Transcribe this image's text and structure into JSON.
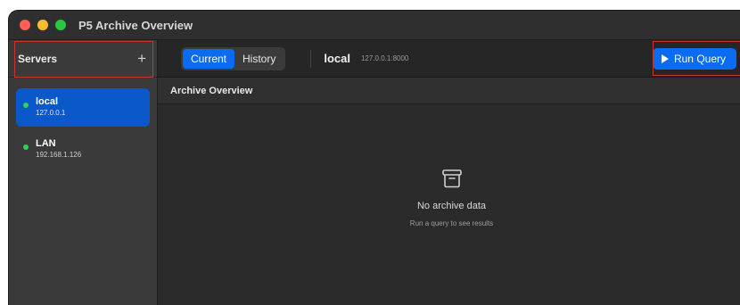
{
  "window": {
    "title": "P5 Archive Overview"
  },
  "sidebar": {
    "header": "Servers",
    "add_label": "+",
    "servers": [
      {
        "name": "local",
        "address": "127.0.0.1",
        "status": "online",
        "selected": true
      },
      {
        "name": "LAN",
        "address": "192.168.1.126",
        "status": "online",
        "selected": false
      }
    ]
  },
  "toolbar": {
    "tabs": [
      {
        "label": "Current",
        "active": true
      },
      {
        "label": "History",
        "active": false
      }
    ],
    "connection_name": "local",
    "connection_address": "127.0.0.1:8000",
    "run_button": "Run Query"
  },
  "main": {
    "section_title": "Archive Overview",
    "empty_title": "No archive data",
    "empty_subtitle": "Run a query to see results"
  },
  "colors": {
    "accent": "#0a6cf1",
    "status_online": "#30d158",
    "highlight": "#c0392b"
  },
  "icons": [
    "add-icon",
    "status-dot-icon",
    "play-icon",
    "archive-box-icon"
  ]
}
